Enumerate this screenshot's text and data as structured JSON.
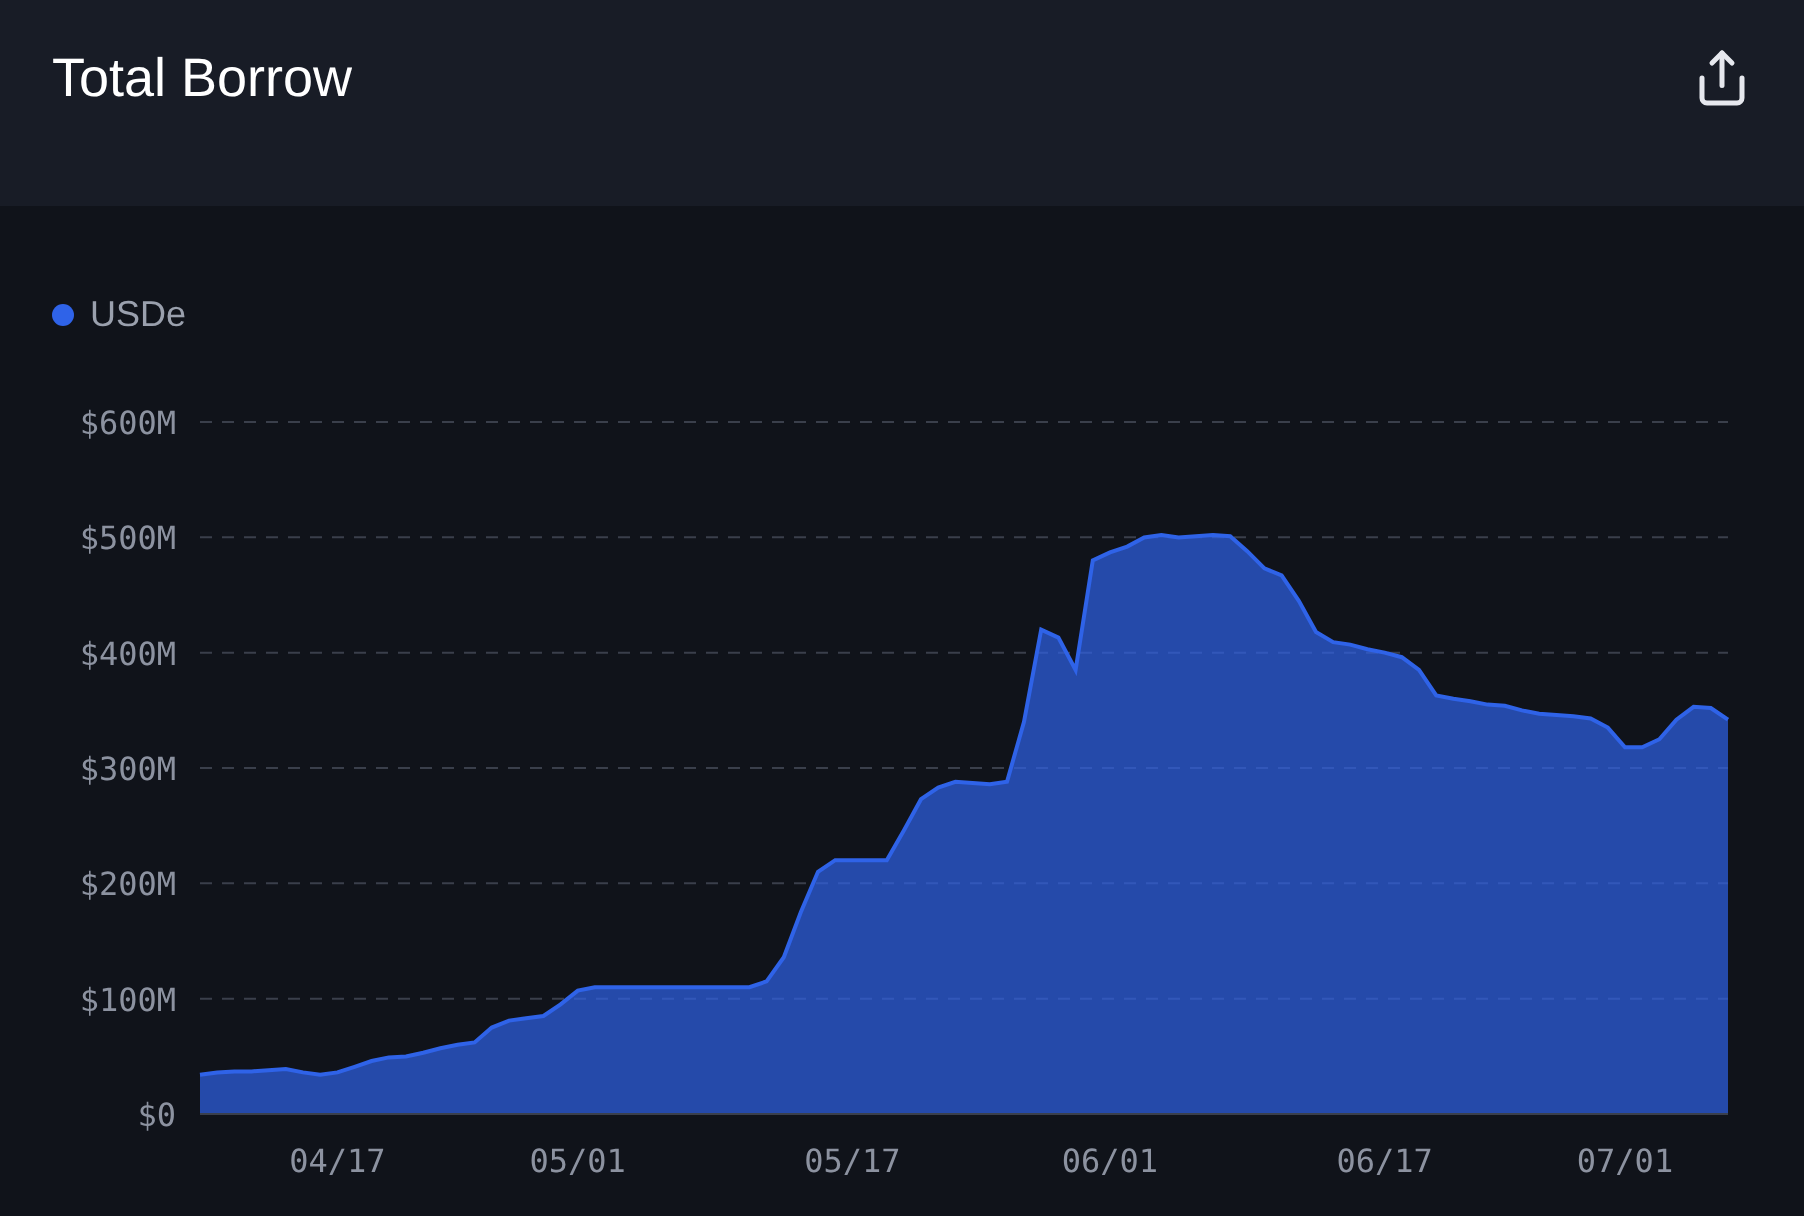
{
  "header": {
    "title": "Total Borrow"
  },
  "chart": {
    "chart_data": {
      "type": "area",
      "grid": true,
      "ylim": [
        0,
        600
      ],
      "yticks": [
        {
          "value": 0,
          "label": "$0"
        },
        {
          "value": 100,
          "label": "$100M"
        },
        {
          "value": 200,
          "label": "$200M"
        },
        {
          "value": 300,
          "label": "$300M"
        },
        {
          "value": 400,
          "label": "$400M"
        },
        {
          "value": 500,
          "label": "$500M"
        },
        {
          "value": 600,
          "label": "$600M"
        }
      ],
      "categories": [
        null,
        null,
        null,
        null,
        null,
        null,
        null,
        null,
        "04/17",
        null,
        null,
        null,
        null,
        null,
        null,
        null,
        null,
        null,
        null,
        null,
        null,
        null,
        "05/01",
        null,
        null,
        null,
        null,
        null,
        null,
        null,
        null,
        null,
        null,
        null,
        null,
        null,
        null,
        null,
        "05/17",
        null,
        null,
        null,
        null,
        null,
        null,
        null,
        null,
        null,
        null,
        null,
        null,
        null,
        null,
        "06/01",
        null,
        null,
        null,
        null,
        null,
        null,
        null,
        null,
        null,
        null,
        null,
        null,
        null,
        null,
        null,
        "06/17",
        null,
        null,
        null,
        null,
        null,
        null,
        null,
        null,
        null,
        null,
        null,
        null,
        null,
        "07/01",
        null,
        null,
        null,
        null,
        null,
        null
      ],
      "series": [
        {
          "name": "USDe",
          "color": "#2f63e8",
          "values": [
            34,
            36,
            37,
            37,
            38,
            39,
            36,
            34,
            36,
            41,
            46,
            49,
            50,
            53,
            57,
            60,
            62,
            75,
            81,
            83,
            85,
            95,
            107,
            110,
            110,
            110,
            110,
            110,
            110,
            110,
            110,
            110,
            110,
            115,
            136,
            175,
            210,
            220,
            220,
            220,
            220,
            246,
            273,
            283,
            288,
            287,
            286,
            288,
            340,
            420,
            413,
            385,
            480,
            487,
            492,
            500,
            502,
            500,
            501,
            502,
            501,
            488,
            473,
            467,
            445,
            418,
            409,
            407,
            403,
            400,
            396,
            385,
            363,
            360,
            358,
            355,
            354,
            350,
            347,
            346,
            345,
            343,
            335,
            318,
            318,
            325,
            342,
            353,
            352,
            342
          ]
        }
      ]
    }
  }
}
